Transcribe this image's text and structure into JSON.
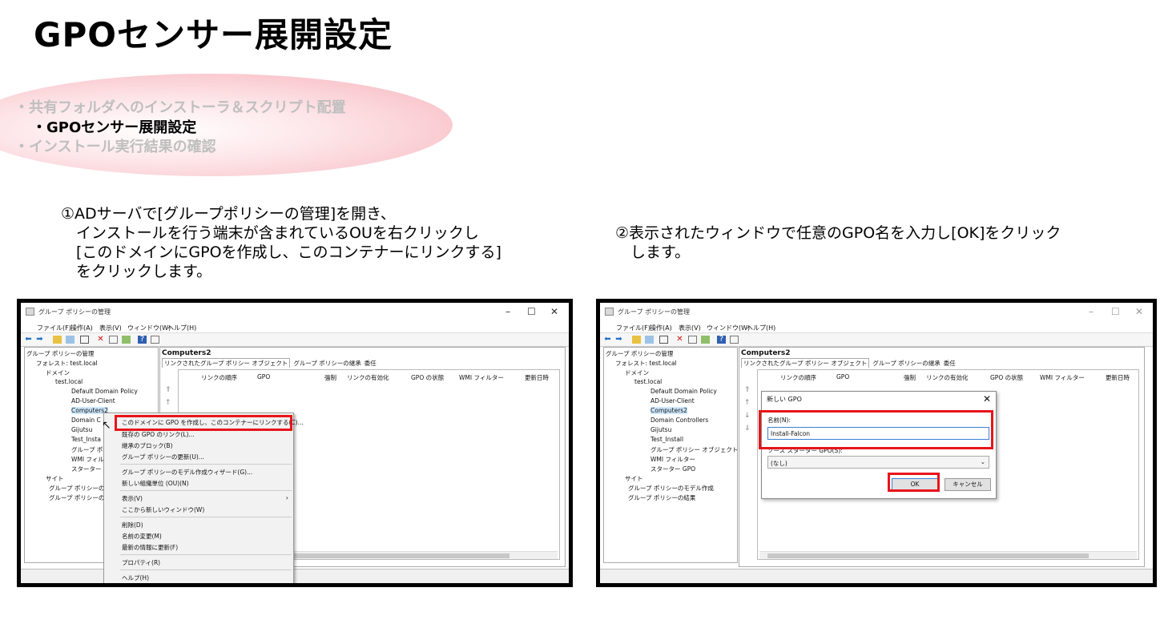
{
  "slide": {
    "title": "GPOセンサー展開設定",
    "toc": [
      "・共有フォルダへのインストーラ＆スクリプト配置",
      "・GPOセンサー展開設定",
      "・インストール実行結果の確認"
    ],
    "step1": "①ADサーバで[グループポリシーの管理]を開き、\n　インストールを行う端末が含まれているOUを右クリックし\n　[このドメインにGPOを作成し、このコンテナーにリンクする]\n　をクリックします。",
    "step2": "②表示されたウィンドウで任意のGPO名を入力し[OK]をクリック\n　します。"
  },
  "window": {
    "title": "グループ ポリシーの管理",
    "menu": [
      "ファイル(F)",
      "操作(A)",
      "表示(V)",
      "ウィンドウ(W)",
      "ヘルプ(H)"
    ],
    "right_title": "Computers2",
    "tabs": [
      "リンクされたグループ ポリシー オブジェクト",
      "グループ ポリシーの継承",
      "委任"
    ],
    "columns": [
      "リンクの順序",
      "GPO",
      "強制",
      "リンクの有効化",
      "GPO の状態",
      "WMI フィルター",
      "更新日時"
    ]
  },
  "tree1": [
    "グループ ポリシーの管理",
    "フォレスト: test.local",
    "ドメイン",
    "test.local",
    "Default Domain Policy",
    "AD-User-Client",
    "Computers2",
    "Domain C",
    "Gijutsu",
    "Test_Insta",
    "グループ ポリ",
    "WMI フィル",
    "スターター G",
    "サイト",
    "グループ ポリシーの",
    "グループ ポリシーの"
  ],
  "tree2": [
    "グループ ポリシーの管理",
    "フォレスト: test.local",
    "ドメイン",
    "test.local",
    "Default Domain Policy",
    "AD-User-Client",
    "Computers2",
    "Domain Controllers",
    "Gijutsu",
    "Test_Install",
    "グループ ポリシー オブジェクト",
    "WMI フィルター",
    "スターター GPO",
    "サイト",
    "グループ ポリシーのモデル作成",
    "グループ ポリシーの結果"
  ],
  "context_menu": [
    "このドメインに GPO を作成し、このコンテナーにリンクする(C)...",
    "既存の GPO のリンク(L)...",
    "継承のブロック(B)",
    "グループ ポリシーの更新(U)...",
    "グループ ポリシーのモデル作成ウィザード(G)...",
    "新しい組織単位 (OU)(N)",
    "表示(V)",
    "ここから新しいウィンドウ(W)",
    "削除(D)",
    "名前の変更(M)",
    "最新の情報に更新(F)",
    "プロパティ(R)",
    "ヘルプ(H)"
  ],
  "dialog": {
    "title": "新しい GPO",
    "name_label": "名前(N):",
    "name_value": "Install-Falcon",
    "source_label": "ソース スターター GPO(S):",
    "source_value": "(なし)",
    "ok": "OK",
    "cancel": "キャンセル"
  },
  "colors": {
    "highlight": "#e8141b",
    "selected": "#cde8ff"
  }
}
